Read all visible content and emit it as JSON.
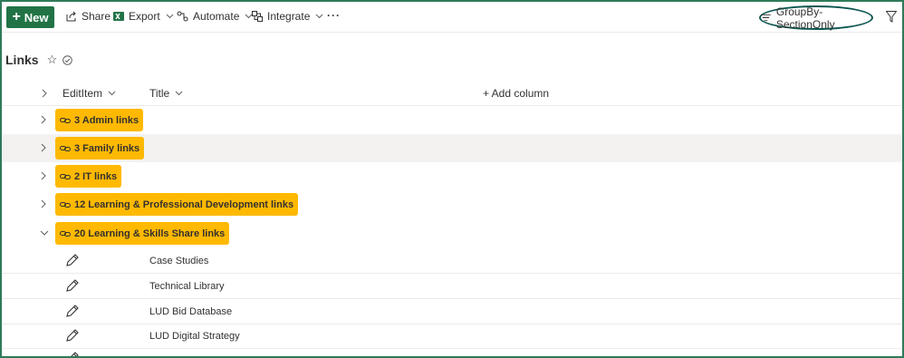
{
  "toolbar": {
    "new_label": "New",
    "share_label": "Share",
    "export_label": "Export",
    "automate_label": "Automate",
    "integrate_label": "Integrate",
    "more_label": "···",
    "view_label": "GroupBy-SectionOnly"
  },
  "page": {
    "title": "Links"
  },
  "columns": {
    "edititem": "EditItem",
    "title": "Title",
    "add_column": "+ Add column"
  },
  "groups": [
    {
      "label": "3 Admin links",
      "expanded": false
    },
    {
      "label": "3 Family links",
      "expanded": false,
      "highlighted": true
    },
    {
      "label": "2 IT links",
      "expanded": false
    },
    {
      "label": "12 Learning & Professional Development links",
      "expanded": false
    },
    {
      "label": "20 Learning & Skills Share links",
      "expanded": true
    }
  ],
  "rows": [
    {
      "title": "Case Studies"
    },
    {
      "title": "Technical Library"
    },
    {
      "title": "LUD Bid Database"
    },
    {
      "title": "LUD Digital Strategy"
    }
  ],
  "colors": {
    "accent": "#217346",
    "group_pill": "#ffb900",
    "frame": "#2f7a5a"
  }
}
